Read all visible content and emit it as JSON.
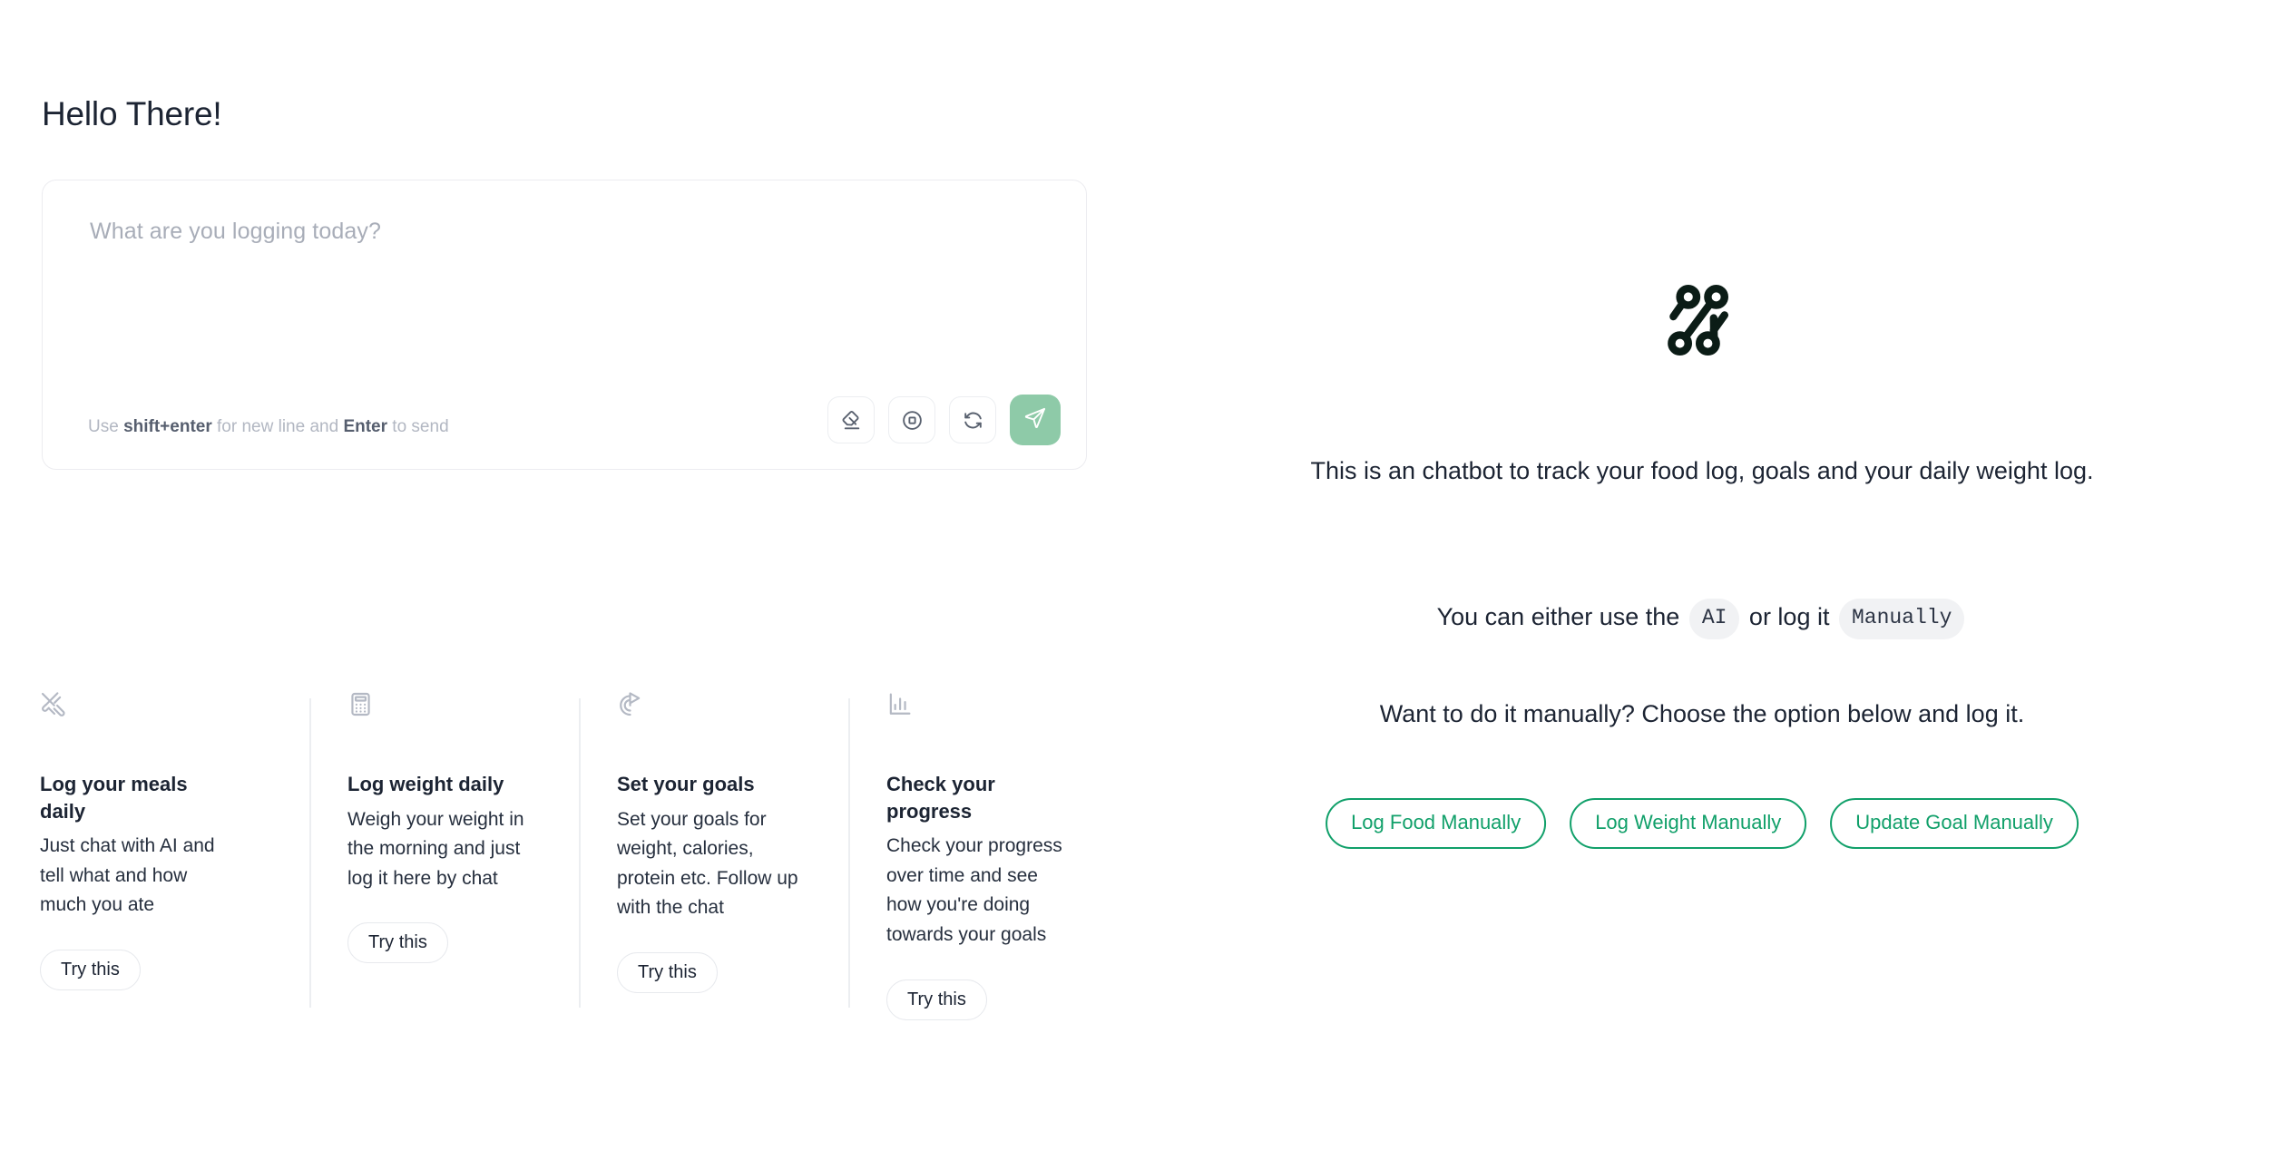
{
  "left": {
    "greeting": "Hello There!",
    "composer": {
      "placeholder": "What are you logging today?",
      "hint_prefix": "Use ",
      "hint_bold_1": "shift+enter",
      "hint_middle": " for new line and ",
      "hint_bold_2": "Enter",
      "hint_suffix": " to send",
      "actions": [
        {
          "name": "eraser-icon",
          "label": "Clear"
        },
        {
          "name": "stop-circle-icon",
          "label": "Stop"
        },
        {
          "name": "refresh-icon",
          "label": "Refresh"
        }
      ],
      "send_label": "Send",
      "send_icon": "send-icon",
      "send_color": "#8ecaa8"
    },
    "cards": [
      {
        "icon": "utensils-crossed-icon",
        "title": "Log your meals daily",
        "description": "Just chat with AI and tell what and how much you ate",
        "button": "Try this"
      },
      {
        "icon": "calculator-icon",
        "title": "Log weight daily",
        "description": "Weigh your weight in the morning and just log it here by chat",
        "button": "Try this"
      },
      {
        "icon": "goal-target-icon",
        "title": "Set your goals",
        "description": "Set your goals for weight, calories, protein etc. Follow up with the chat",
        "button": "Try this"
      },
      {
        "icon": "bar-chart-icon",
        "title": "Check your progress",
        "description": "Check your progress over time and see how you're doing towards your goals",
        "button": "Try this"
      }
    ]
  },
  "right": {
    "logo_icon": "brand-percent-nodes-icon",
    "intro": "This is an chatbot to track your food log, goals and your daily weight log.",
    "mode_line": {
      "prefix": "You can either use the ",
      "chip_1": "AI",
      "middle": " or log it ",
      "chip_2": "Manually"
    },
    "manual_prompt": "Want to do it manually? Choose the option below and log it.",
    "manual_buttons": [
      {
        "label": "Log Food Manually"
      },
      {
        "label": "Log Weight Manually"
      },
      {
        "label": "Update Goal Manually"
      }
    ],
    "accent_green": "#11a06a"
  }
}
